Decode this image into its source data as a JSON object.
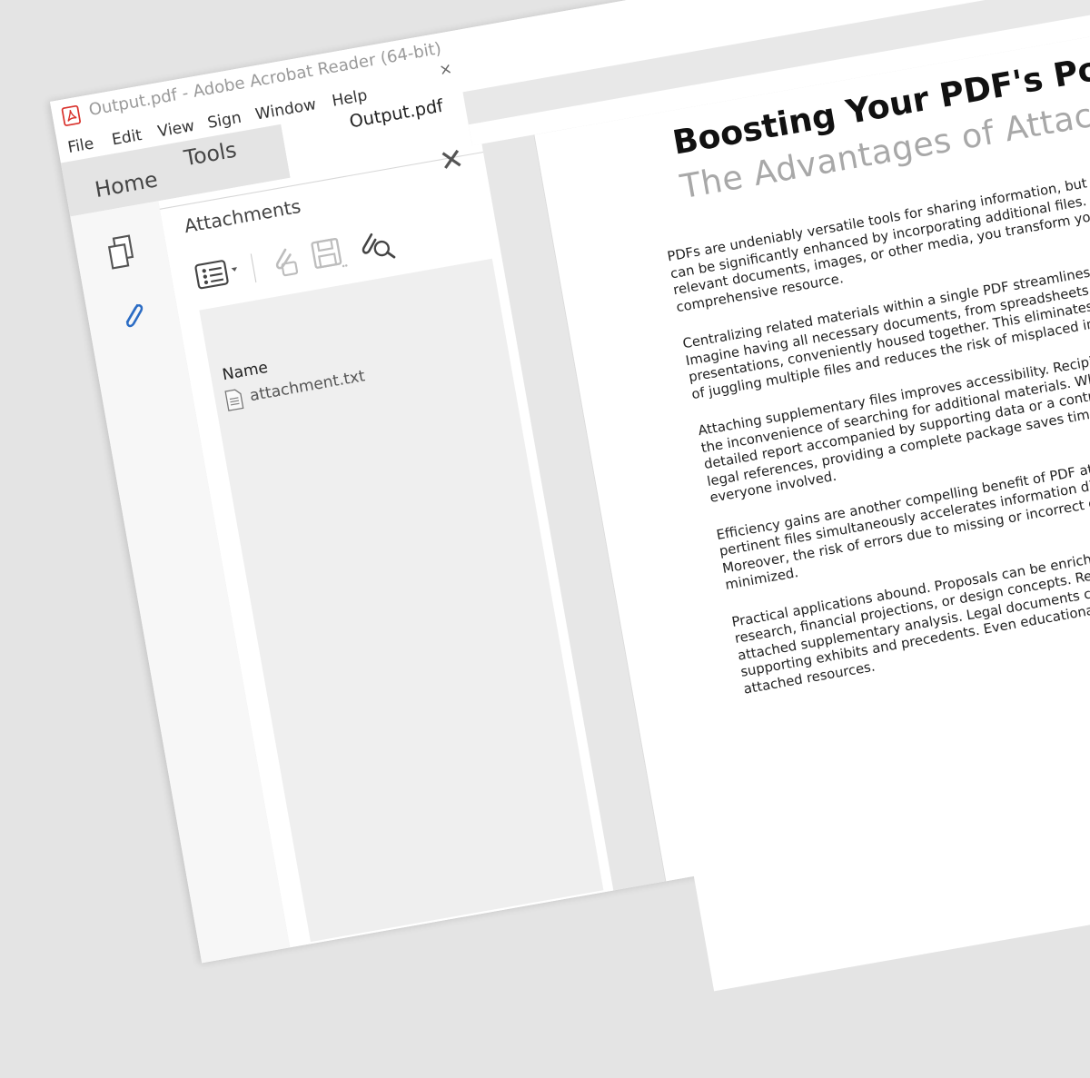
{
  "window": {
    "title": "Output.pdf - Adobe Acrobat Reader (64-bit)"
  },
  "menu": {
    "file": "File",
    "edit": "Edit",
    "view": "View",
    "sign": "Sign",
    "window": "Window",
    "help": "Help"
  },
  "tabs": {
    "home": "Home",
    "tools": "Tools",
    "document": "Output.pdf",
    "close": "×"
  },
  "attachments_panel": {
    "title": "Attachments",
    "close": "✕",
    "column_name": "Name",
    "files": [
      {
        "name": "attachment.txt"
      }
    ]
  },
  "document": {
    "title": "Boosting Your PDF's Potential",
    "subtitle": "The Advantages of Attached Files",
    "paragraphs": [
      "PDFs are undeniably versatile tools for sharing information, but their utility can be significantly enhanced by incorporating additional files. By attaching relevant documents, images, or other media, you transform your PDF into a comprehensive resource.",
      "Centralizing related materials within a single PDF streamlines organization. Imagine having all necessary documents, from spreadsheets to presentations, conveniently housed together. This eliminates the frustration of juggling multiple files and reduces the risk of misplaced information.",
      "Attaching supplementary files improves accessibility. Recipients are spared the inconvenience of searching for additional materials. Whether it's a detailed report accompanied by supporting data or a contract with attached legal references, providing a complete package saves time and effort for everyone involved.",
      "Efficiency gains are another compelling benefit of PDF attachments. Sharing pertinent files simultaneously accelerates information dissemination. Moreover, the risk of errors due to missing or incorrect documents is minimized.",
      "Practical applications abound. Proposals can be enriched with market research, financial projections, or design concepts. Reports gain depth with attached supplementary analysis. Legal documents can incorporate supporting exhibits and precedents. Even educational materials benefit from attached resources."
    ]
  },
  "colors": {
    "accent": "#2b6cc4",
    "pdf_red": "#d9312b"
  }
}
